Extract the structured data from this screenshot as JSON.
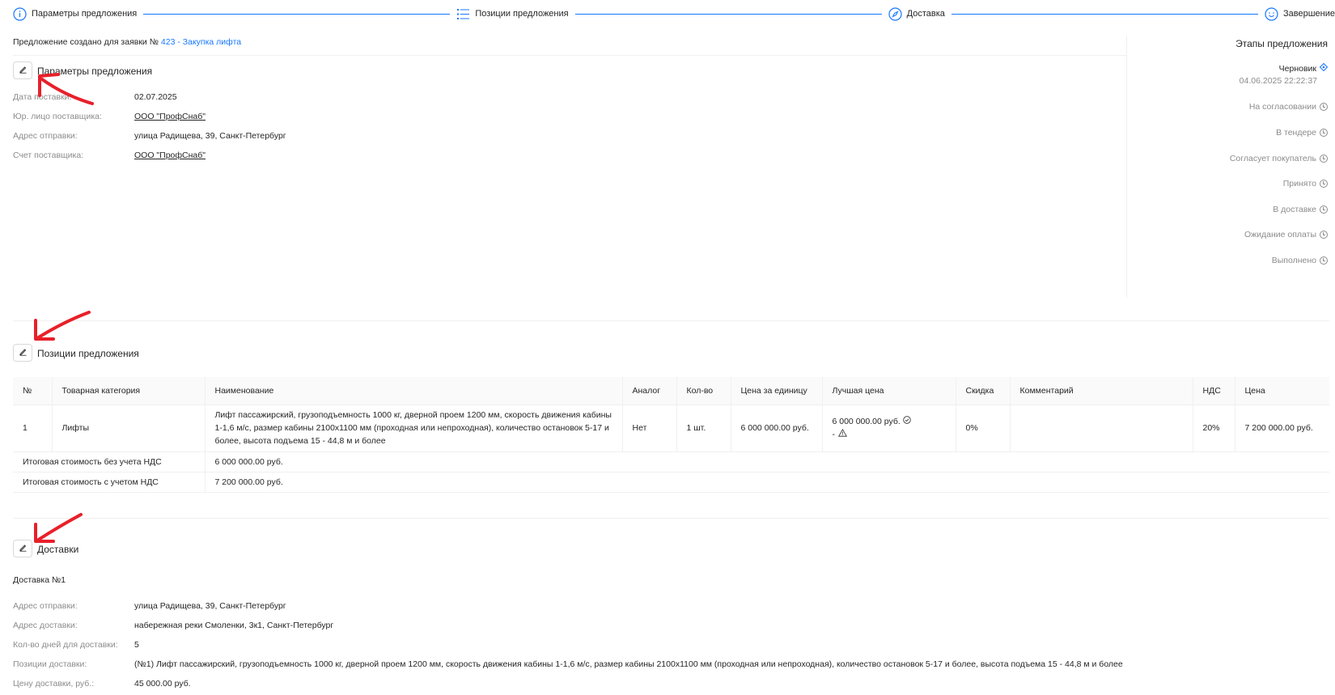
{
  "stepper": {
    "steps": [
      {
        "label": "Параметры предложения",
        "icon": "info-circle-icon"
      },
      {
        "label": "Позиции предложения",
        "icon": "list-icon"
      },
      {
        "label": "Доставка",
        "icon": "compass-icon"
      },
      {
        "label": "Завершение",
        "icon": "smile-icon"
      }
    ],
    "accent": "#1677ff"
  },
  "created": {
    "prefix": "Предложение создано для заявки №",
    "request_link": "423 - Закупка лифта"
  },
  "params": {
    "title": "Параметры предложения",
    "fields": [
      {
        "label": "Дата поставки:",
        "value": "02.07.2025"
      },
      {
        "label": "Юр. лицо поставщика:",
        "value": "ООО \"ПрофСнаб\""
      },
      {
        "label": "Адрес отправки:",
        "value": "улица Радищева, 39, Санкт-Петербург"
      },
      {
        "label": "Счет поставщика:",
        "value": "ООО \"ПрофСнаб\""
      }
    ]
  },
  "stages": {
    "title": "Этапы предложения",
    "items": [
      {
        "label": "Черновик"
      },
      {
        "label": "На согласовании"
      },
      {
        "label": "В тендере"
      },
      {
        "label": "Согласует покупатель"
      },
      {
        "label": "Принято"
      },
      {
        "label": "В доставке"
      },
      {
        "label": "Ожидание оплаты"
      },
      {
        "label": "Выполнено"
      }
    ],
    "draft_time": "04.06.2025 22:22:37"
  },
  "positions": {
    "title": "Позиции предложения",
    "columns": [
      "№",
      "Товарная категория",
      "Наименование",
      "Аналог",
      "Кол-во",
      "Цена за единицу",
      "Лучшая цена",
      "Скидка",
      "Комментарий",
      "НДС",
      "Цена"
    ],
    "rows": [
      {
        "num": "1",
        "category": "Лифты",
        "name": "Лифт пассажирский, грузоподъемность 1000 кг, дверной проем 1200 мм, скорость движения кабины 1-1,6 м/с, размер кабины 2100x1100 мм (проходная или непроходная), количество остановок 5-17 и более, высота подъема 15 - 44,8 м и более",
        "analog": "Нет",
        "qty": "1 шт.",
        "unit_price": "6 000 000.00 руб.",
        "best_price": "6 000 000.00 руб.",
        "best_price_note": "-",
        "discount": "0%",
        "comment": "",
        "vat": "20%",
        "price": "7 200 000.00 руб."
      }
    ],
    "totals": [
      {
        "label": "Итоговая стоимость без учета НДС",
        "value": "6 000 000.00 руб."
      },
      {
        "label": "Итоговая стоимость с учетом НДС",
        "value": "7 200 000.00 руб."
      }
    ]
  },
  "delivery": {
    "title": "Доставки",
    "subtitle": "Доставка №1",
    "fields": [
      {
        "label": "Адрес отправки:",
        "value": "улица Радищева, 39, Санкт-Петербург"
      },
      {
        "label": "Адрес доставки:",
        "value": "набережная реки Смоленки, 3к1, Санкт-Петербург"
      },
      {
        "label": "Кол-во дней для доставки:",
        "value": "5"
      },
      {
        "label": "Позиции доставки:",
        "value": "(№1) Лифт пассажирский, грузоподъемность 1000 кг, дверной проем 1200 мм, скорость движения кабины 1-1,6 м/с, размер кабины 2100x1100 мм (проходная или непроходная), количество остановок 5-17 и более, высота подъема 15 - 44,8 м и более"
      },
      {
        "label": "Цену доставки, руб.:",
        "value": "45 000.00 руб."
      }
    ]
  },
  "annotation_color": "#e8202a"
}
